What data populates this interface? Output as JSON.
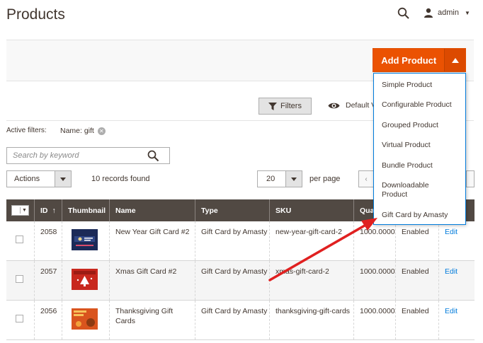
{
  "header": {
    "title": "Products",
    "user": "admin",
    "search_icon": "search-icon",
    "user_icon": "user-icon"
  },
  "add_product": {
    "label": "Add Product",
    "accent": "#eb5202",
    "menu": [
      "Simple Product",
      "Configurable Product",
      "Grouped Product",
      "Virtual Product",
      "Bundle Product",
      "Downloadable Product",
      "Gift Card by Amasty"
    ]
  },
  "toolbar": {
    "filters_label": "Filters",
    "default_view_label": "Default V",
    "active_filters_label": "Active filters:",
    "active_filter_chip": "Name: gift",
    "search_placeholder": "Search by keyword",
    "actions_label": "Actions",
    "records_found": "10 records found",
    "per_page_value": "20",
    "per_page_label": "per page"
  },
  "grid": {
    "columns": [
      "",
      "ID",
      "Thumbnail",
      "Name",
      "Type",
      "SKU",
      "Qua",
      "",
      ""
    ],
    "id_sort_arrow": "↑",
    "rows": [
      {
        "id": "2058",
        "name": "New Year Gift Card #2",
        "type": "Gift Card by Amasty",
        "sku": "new-year-gift-card-2",
        "qty": "1000.0000",
        "visibility": "Enabled",
        "action": "Edit",
        "thumb_color": "#1b2a57"
      },
      {
        "id": "2057",
        "name": "Xmas Gift Card #2",
        "type": "Gift Card by Amasty",
        "sku": "xmas-gift-card-2",
        "qty": "1000.0000",
        "visibility": "Enabled",
        "action": "Edit",
        "thumb_color": "#c8281e"
      },
      {
        "id": "2056",
        "name": "Thanksgiving Gift Cards",
        "type": "Gift Card by Amasty",
        "sku": "thanksgiving-gift-cards",
        "qty": "1000.0000",
        "visibility": "Enabled",
        "action": "Edit",
        "thumb_color": "#d9541e"
      }
    ]
  },
  "annotation": {
    "arrow_color": "#e02020"
  }
}
